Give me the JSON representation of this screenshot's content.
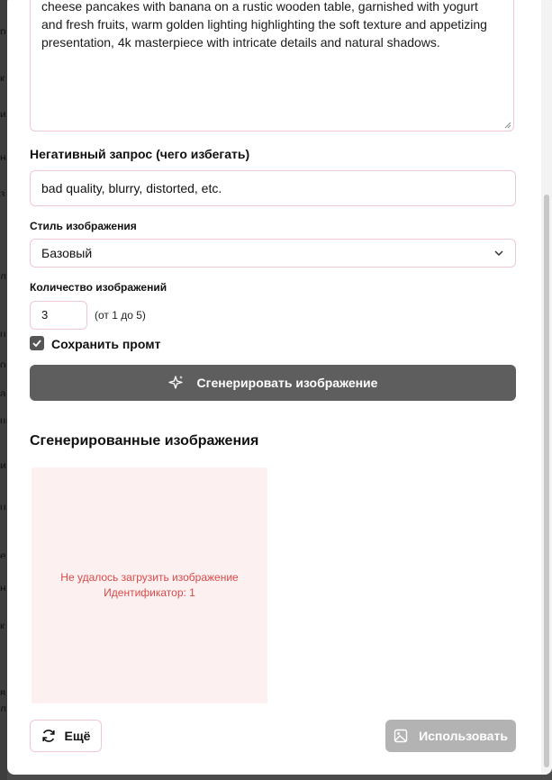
{
  "background": {
    "edge_glyphs": [
      "р",
      "к",
      "и",
      "н",
      "з",
      "л",
      "ц",
      "о",
      "а",
      "щ",
      "и",
      "u",
      "е",
      "н",
      "к",
      "в",
      "л"
    ]
  },
  "prompt": {
    "value": "cheese pancakes with banana on a rustic wooden table, garnished with yogurt and fresh fruits, warm golden lighting highlighting the soft texture and appetizing presentation, 4k masterpiece with intricate details and natural shadows."
  },
  "negative": {
    "label": "Негативный запрос (чего избегать)",
    "value": "bad quality, blurry, distorted, etc."
  },
  "style": {
    "label": "Стиль изображения",
    "selected": "Базовый",
    "icon": "chevron-down-icon"
  },
  "count": {
    "label": "Количество изображений",
    "value": "3",
    "hint": "(от 1 до 5)"
  },
  "save_prompt": {
    "label": "Сохранить промт",
    "checked": true
  },
  "generate": {
    "label": "Сгенерировать изображение",
    "icon": "sparkles-icon"
  },
  "results": {
    "title": "Сгенерированные изображения",
    "items": [
      {
        "error": "Не удалось загрузить изображение",
        "id_label": "Идентификатор: 1"
      }
    ]
  },
  "footer": {
    "more_label": "Ещё",
    "more_icon": "refresh-icon",
    "use_label": "Использовать",
    "use_icon": "image-icon"
  },
  "colors": {
    "accent_border": "#f0c9d0",
    "primary_button": "#5e5e5e",
    "disabled_button": "#b3b3b3",
    "error_text": "#d94a4a",
    "error_bg": "#fdf0f0"
  }
}
